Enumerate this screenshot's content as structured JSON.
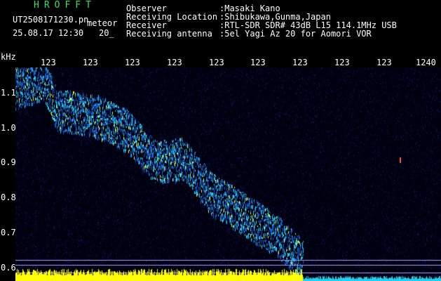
{
  "app": {
    "title": "HROFFT"
  },
  "header": {
    "filename": "UT2508171230.pn",
    "tag": "meteor",
    "datetime": "25.08.17 12:30",
    "number": "20_",
    "rows": [
      {
        "label": "Observer",
        "value": ":Masaki Kano"
      },
      {
        "label": "Receiving Location",
        "value": ":Shibukawa,Gunma,Japan"
      },
      {
        "label": "Receiver",
        "value": ":RTL-SDR SDR# 43dB L15 114.1MHz USB"
      },
      {
        "label": "Receiving antenna",
        "value": ":5el Yagi Az 20 for Aomori VOR"
      }
    ]
  },
  "axes": {
    "y_unit": "kHz",
    "y_ticks": [
      "1.1",
      "1.0",
      "0.9",
      "0.8",
      "0.7",
      "0.6"
    ],
    "x_ticks": [
      "123",
      "123",
      "123",
      "123",
      "123",
      "123",
      "123",
      "123",
      "123",
      "1240"
    ]
  },
  "colors": {
    "background": "#000010",
    "noise": "#0a1a6e",
    "signal_low": "#1060d0",
    "signal_mid": "#20d0f0",
    "signal_high": "#f0f040",
    "baseline_bar": "#ffff00",
    "hline": "#a0a0ff"
  }
}
